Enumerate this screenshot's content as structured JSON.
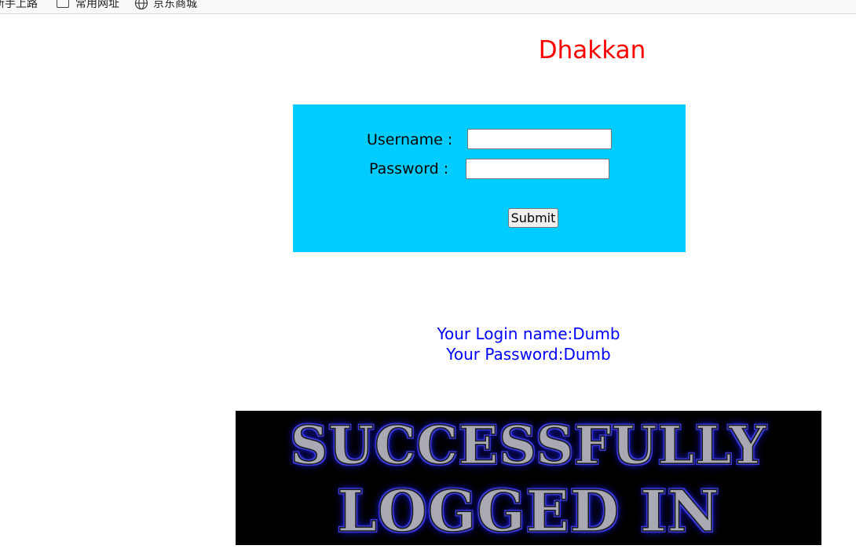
{
  "bookmarks": {
    "items": [
      {
        "label": "新手上路",
        "icon": "none"
      },
      {
        "label": "常用网址",
        "icon": "folder-icon"
      },
      {
        "label": "京东商城",
        "icon": "globe-icon"
      }
    ]
  },
  "page": {
    "title": "Dhakkan"
  },
  "login_form": {
    "username_label": "Username :",
    "password_label": "Password :",
    "username_value": "",
    "password_value": "",
    "submit_label": "Submit",
    "background_color": "#00ccff"
  },
  "result": {
    "login_name_line": "Your Login name:Dumb",
    "password_line": "Your Password:Dumb",
    "color": "#0000ff"
  },
  "banner": {
    "line1": "SUCCESSFULLY",
    "line2": "LOGGED IN"
  }
}
